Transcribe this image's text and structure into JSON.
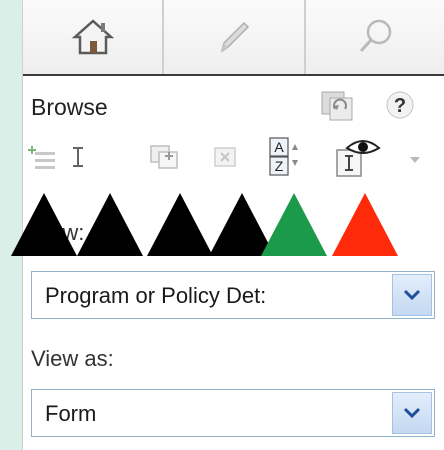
{
  "nav": {
    "items": [
      {
        "name": "home-icon"
      },
      {
        "name": "pencil-icon"
      },
      {
        "name": "search-icon"
      }
    ]
  },
  "header": {
    "title": "Browse",
    "icons": [
      "refresh-icon",
      "help-icon"
    ]
  },
  "toolbar": {
    "icons": [
      "add-item-icon",
      "text-cursor-icon",
      "insert-child-icon",
      "remove-icon",
      "sort-az-icon",
      "view-fields-icon",
      "more-dropdown-icon"
    ]
  },
  "annotations": {
    "colors": [
      "#000000",
      "#000000",
      "#000000",
      "#000000",
      "#1a9a4a",
      "#ff2a0a"
    ]
  },
  "form": {
    "view_label": "View:",
    "view_value": "Program or Policy Det:",
    "view_as_label": "View as:",
    "view_as_value": "Form"
  }
}
